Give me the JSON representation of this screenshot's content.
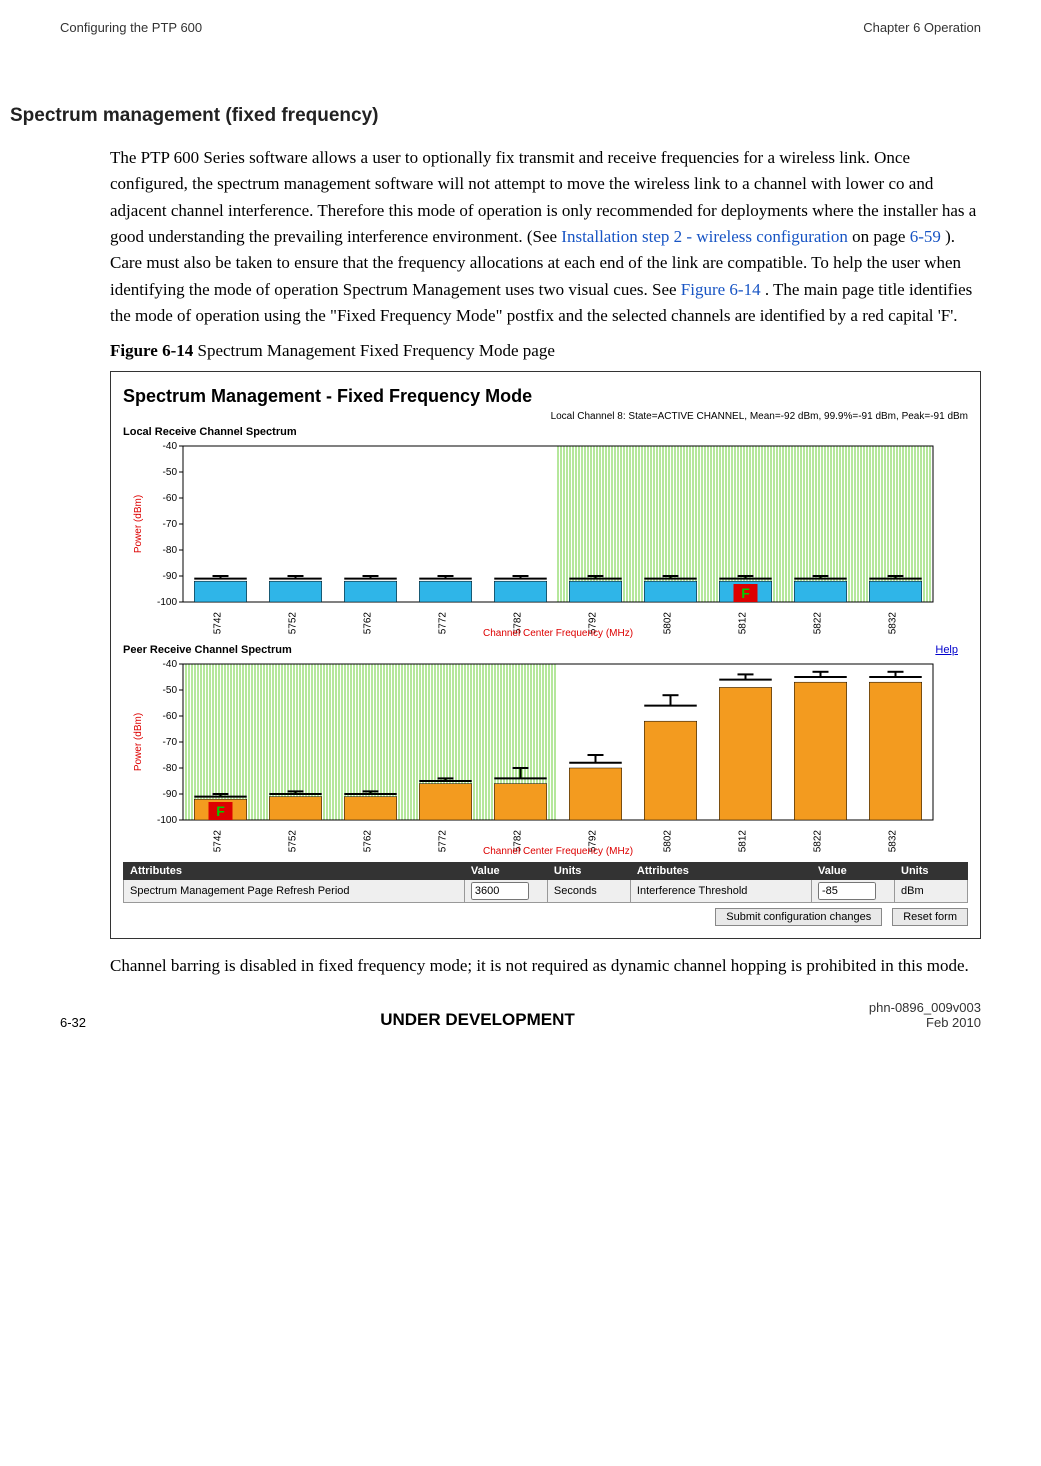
{
  "header": {
    "left": "Configuring the PTP 600",
    "right": "Chapter 6 Operation"
  },
  "heading": "Spectrum management (fixed frequency)",
  "para1_a": "The PTP 600 Series software allows a user to optionally fix transmit and receive frequencies for a wireless link. Once configured, the spectrum management software will not attempt to move the wireless link to a channel with lower co and adjacent channel interference. Therefore this mode of operation is only recommended for deployments where the installer has a good understanding the prevailing interference environment. (See ",
  "para1_link1": "Installation step 2 - wireless configuration",
  "para1_b": " on page ",
  "para1_link2": "6-59",
  "para1_c": "). Care must also be taken to ensure that the frequency allocations at each end of the link are compatible. To help the user when identifying the mode of operation Spectrum Management uses two visual cues. See ",
  "para1_link3": "Figure 6-14",
  "para1_d": ". The main page title identifies the mode of operation using the \"Fixed Frequency Mode\" postfix and the selected channels are identified by a red capital 'F'.",
  "figcap_bold": "Figure 6-14",
  "figcap_rest": "  Spectrum Management Fixed Frequency Mode page",
  "fig_title": "Spectrum Management - Fixed Frequency Mode",
  "fig_sub": "Local Channel 8: State=ACTIVE CHANNEL, Mean=-92 dBm, 99.9%=-91 dBm, Peak=-91 dBm",
  "local_title": "Local Receive Channel Spectrum",
  "peer_title": "Peer Receive Channel Spectrum",
  "help": "Help",
  "ylabel": "Power (dBm)",
  "xlabel": "Channel Center Frequency (MHz)",
  "attr": {
    "h_attr": "Attributes",
    "h_val": "Value",
    "h_units": "Units",
    "r1a": "Spectrum Management Page Refresh Period",
    "r1v": "3600",
    "r1u": "Seconds",
    "r2a": "Interference Threshold",
    "r2v": "-85",
    "r2u": "dBm"
  },
  "btn_submit": "Submit configuration changes",
  "btn_reset": "Reset form",
  "para2": "Channel barring is disabled in fixed frequency mode; it is not required as dynamic channel hopping is prohibited in this mode.",
  "footer": {
    "left": "6-32",
    "mid": "UNDER DEVELOPMENT",
    "right1": "phn-0896_009v003",
    "right2": "Feb 2010"
  },
  "chart_data": [
    {
      "type": "bar",
      "title": "Local Receive Channel Spectrum",
      "xlabel": "Channel Center Frequency (MHz)",
      "ylabel": "Power (dBm)",
      "ylim": [
        -100,
        -40
      ],
      "categories": [
        "5742",
        "5752",
        "5762",
        "5772",
        "5782",
        "5792",
        "5802",
        "5812",
        "5822",
        "5832"
      ],
      "series": [
        {
          "name": "Mean",
          "values": [
            -92,
            -92,
            -92,
            -92,
            -92,
            -92,
            -92,
            -92,
            -92,
            -92
          ],
          "color": "#2fb5e8"
        },
        {
          "name": "99.9%",
          "values": [
            -91,
            -91,
            -91,
            -91,
            -91,
            -91,
            -91,
            -91,
            -91,
            -91
          ]
        },
        {
          "name": "Peak",
          "values": [
            -90,
            -90,
            -90,
            -90,
            -90,
            -90,
            -90,
            -90,
            -90,
            -90
          ]
        }
      ],
      "fixed_channel_index": 7,
      "active_region": [
        5,
        9
      ]
    },
    {
      "type": "bar",
      "title": "Peer Receive Channel Spectrum",
      "xlabel": "Channel Center Frequency (MHz)",
      "ylabel": "Power (dBm)",
      "ylim": [
        -100,
        -40
      ],
      "categories": [
        "5742",
        "5752",
        "5762",
        "5772",
        "5782",
        "5792",
        "5802",
        "5812",
        "5822",
        "5832"
      ],
      "series": [
        {
          "name": "Mean",
          "values": [
            -92,
            -91,
            -91,
            -86,
            -86,
            -80,
            -62,
            -49,
            -47,
            -47
          ],
          "color": "#f39b1f"
        },
        {
          "name": "99.9%",
          "values": [
            -91,
            -90,
            -90,
            -85,
            -84,
            -78,
            -56,
            -46,
            -45,
            -45
          ]
        },
        {
          "name": "Peak",
          "values": [
            -90,
            -89,
            -89,
            -84,
            -80,
            -75,
            -52,
            -44,
            -43,
            -43
          ]
        }
      ],
      "fixed_channel_index": 0,
      "active_region": [
        0,
        4
      ]
    }
  ]
}
